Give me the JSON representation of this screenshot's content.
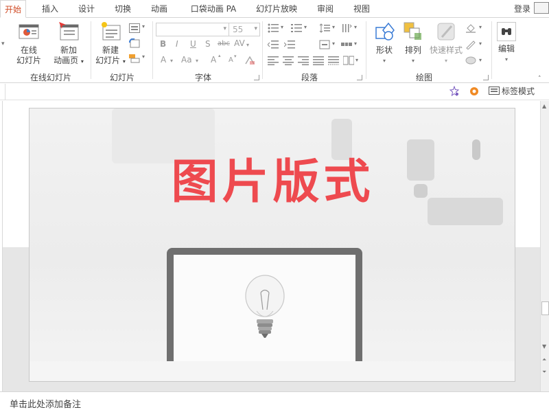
{
  "tabs": [
    {
      "label": "开始",
      "active": true
    },
    {
      "label": "插入"
    },
    {
      "label": "设计"
    },
    {
      "label": "切换"
    },
    {
      "label": "动画"
    },
    {
      "label": "口袋动画 PA"
    },
    {
      "label": "幻灯片放映"
    },
    {
      "label": "审阅"
    },
    {
      "label": "视图"
    }
  ],
  "account": {
    "login_label": "登录"
  },
  "ribbon": {
    "groups": {
      "online_slides": "在线幻灯片",
      "slides": "幻灯片",
      "font": "字体",
      "paragraph": "段落",
      "drawing": "绘图"
    },
    "buttons": {
      "online_slides_line1": "在线",
      "online_slides_line2": "幻灯片",
      "new_anim_line1": "新加",
      "new_anim_line2": "动画页",
      "new_slide_line1": "新建",
      "new_slide_line2": "幻灯片",
      "shapes": "形状",
      "arrange": "排列",
      "quick_styles": "快速样式",
      "editing": "编辑"
    },
    "font": {
      "family_value": "",
      "size_value": "55",
      "bold": "B",
      "italic": "I",
      "underline": "U",
      "strike": "S",
      "strikethrough_demo": "abc",
      "spacing": "AV",
      "grow": "A",
      "shrink": "A",
      "case": "Aa",
      "clear": "A",
      "color": "A"
    }
  },
  "subbar": {
    "tag_mode_label": "标签模式"
  },
  "slide": {
    "title": "图片版式"
  },
  "notes": {
    "placeholder": "单击此处添加备注"
  },
  "colors": {
    "accent": "#d04a24",
    "title_red": "#ee4a4f"
  }
}
